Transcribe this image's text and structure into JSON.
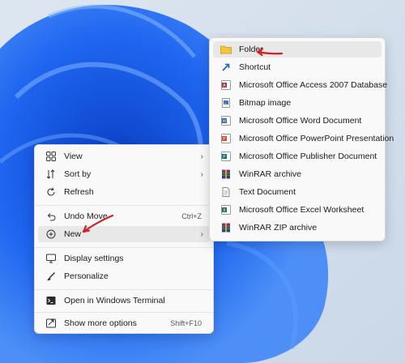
{
  "context_menu": {
    "items": [
      {
        "label": "View",
        "icon": "grid-icon"
      },
      {
        "label": "Sort by",
        "icon": "sort-icon"
      },
      {
        "label": "Refresh",
        "icon": "refresh-icon"
      },
      {
        "label": "Undo Move",
        "icon": "undo-icon",
        "shortcut": "Ctrl+Z"
      },
      {
        "label": "New",
        "icon": "add-circle-icon"
      },
      {
        "label": "Display settings",
        "icon": "display-icon"
      },
      {
        "label": "Personalize",
        "icon": "brush-icon"
      },
      {
        "label": "Open in Windows Terminal",
        "icon": "terminal-icon"
      },
      {
        "label": "Show more options",
        "icon": "more-options-icon",
        "shortcut": "Shift+F10"
      }
    ]
  },
  "new_submenu": {
    "items": [
      {
        "label": "Folder",
        "icon": "folder-icon"
      },
      {
        "label": "Shortcut",
        "icon": "shortcut-icon"
      },
      {
        "label": "Microsoft Office Access 2007 Database",
        "icon": "access-icon"
      },
      {
        "label": "Bitmap image",
        "icon": "bitmap-icon"
      },
      {
        "label": "Microsoft Office Word Document",
        "icon": "word-icon"
      },
      {
        "label": "Microsoft Office PowerPoint Presentation",
        "icon": "powerpoint-icon"
      },
      {
        "label": "Microsoft Office Publisher Document",
        "icon": "publisher-icon"
      },
      {
        "label": "WinRAR archive",
        "icon": "winrar-icon"
      },
      {
        "label": "Text Document",
        "icon": "text-document-icon"
      },
      {
        "label": "Microsoft Office Excel Worksheet",
        "icon": "excel-icon"
      },
      {
        "label": "WinRAR ZIP archive",
        "icon": "winrar-zip-icon"
      }
    ]
  },
  "colors": {
    "annotation_arrow": "#d0212a",
    "wallpaper_blue": "#1f5fe0"
  }
}
